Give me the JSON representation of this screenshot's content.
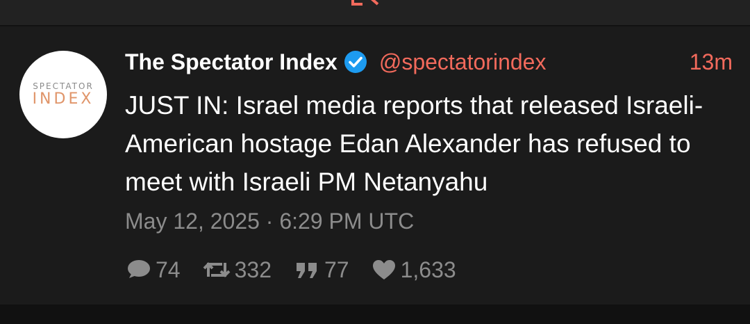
{
  "tweet": {
    "display_name": "The Spectator Index",
    "handle": "@spectatorindex",
    "relative_time": "13m",
    "text": "JUST IN: Israel media reports that released Israeli-American hostage Edan Alexander has refused to meet with Israeli PM Netanyahu",
    "timestamp": "May 12, 2025 · 6:29 PM UTC",
    "avatar": {
      "logo_line1": "SPECTATOR",
      "logo_line2": "INDEX"
    },
    "verified_icon": "verified-badge-icon",
    "stats": {
      "replies": "74",
      "retweets": "332",
      "quotes": "77",
      "likes": "1,633"
    }
  },
  "colors": {
    "accent": "#f26a5c",
    "verified": "#1d9bf0",
    "muted": "#8c8c8c",
    "card_bg": "#1b1b1b",
    "top_bar_bg": "#222222"
  }
}
